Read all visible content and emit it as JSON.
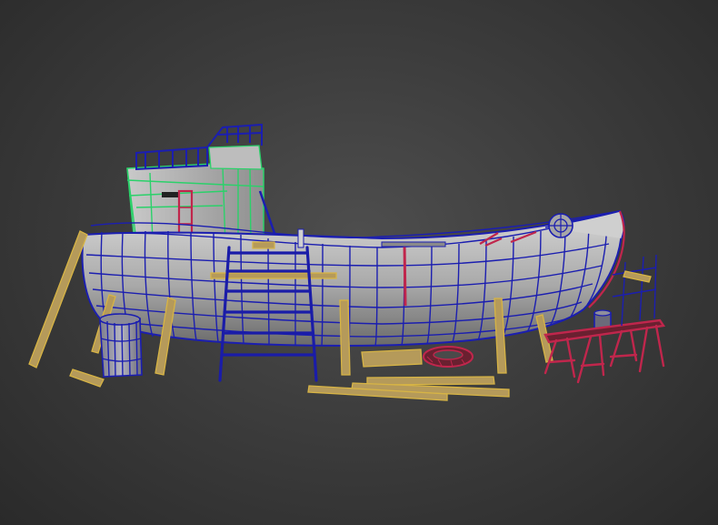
{
  "viewport": {
    "background_color": "#3a3a3a",
    "view": "perspective"
  },
  "scene": {
    "subject": "wireframe-boat-on-stands",
    "wire_colors": {
      "hull": "#1b1eb0",
      "cabin": "#2bd16a",
      "timber": "#d7b445",
      "sawhorse": "#c0264c",
      "ladder": "#1a1ca8"
    }
  }
}
